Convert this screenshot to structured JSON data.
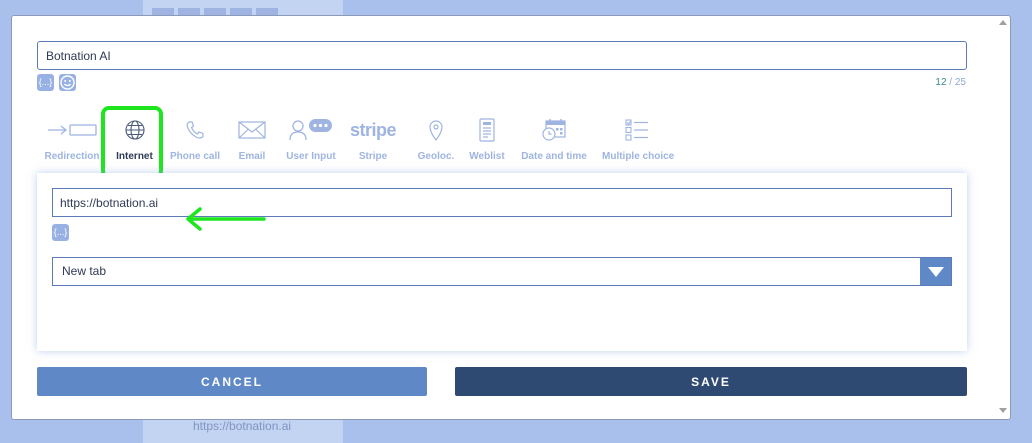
{
  "background": {
    "url_text": "https://botnation.ai"
  },
  "title_input": {
    "value": "Botnation AI"
  },
  "counter": {
    "current": "12",
    "separator": " / ",
    "max": "25"
  },
  "variables_button": {
    "label": "{...}"
  },
  "actions": [
    {
      "label": "Redirection",
      "icon": "redirect-arrow-icon"
    },
    {
      "label": "Internet",
      "icon": "globe-icon",
      "active": true
    },
    {
      "label": "Phone call",
      "icon": "phone-icon"
    },
    {
      "label": "Email",
      "icon": "envelope-icon"
    },
    {
      "label": "User Input",
      "icon": "user-input-icon"
    },
    {
      "label": "Stripe",
      "icon": "stripe-logo"
    },
    {
      "label": "Geoloc.",
      "icon": "location-pin-icon"
    },
    {
      "label": "Weblist",
      "icon": "weblist-icon"
    },
    {
      "label": "Date and time",
      "icon": "calendar-clock-icon"
    },
    {
      "label": "Multiple choice",
      "icon": "checklist-icon"
    }
  ],
  "stripe_logo_text": "stripe",
  "url_input": {
    "value": "https://botnation.ai"
  },
  "target_select": {
    "value": "New tab"
  },
  "footer": {
    "cancel_label": "CANCEL",
    "save_label": "SAVE"
  },
  "colors": {
    "accent": "#5e88c6",
    "save": "#2f4a72",
    "highlight": "#1ee61e",
    "inactive_label": "#9fb4e0"
  }
}
